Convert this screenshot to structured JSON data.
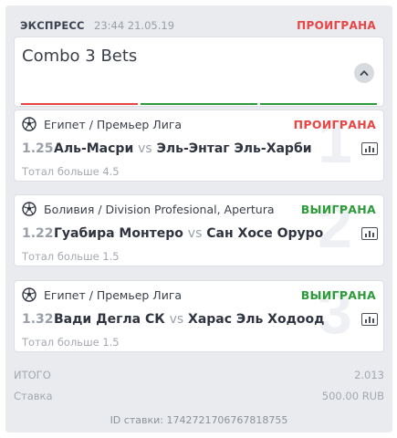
{
  "header": {
    "type": "ЭКСПРЕСС",
    "datetime": "23:44 21.05.19",
    "result": "ПРОИГРАНА",
    "result_color": "#e84545"
  },
  "combo": {
    "title": "Combo 3 Bets",
    "collapse_icon": "chevron-up-icon",
    "segments": [
      {
        "status": "lost",
        "color": "#e84545"
      },
      {
        "status": "won",
        "color": "#2e9b3a"
      },
      {
        "status": "won",
        "color": "#2e9b3a"
      }
    ]
  },
  "bets": [
    {
      "number": "1",
      "league": "Египет / Премьер Лига",
      "status": "ПРОИГРАНА",
      "status_color": "#e84545",
      "odds": "1.25",
      "home": "Аль-Масри",
      "vs": "vs",
      "away": "Эль-Энтаг Эль-Харби",
      "market": "Тотал больше 4.5"
    },
    {
      "number": "2",
      "league": "Боливия / Division Profesional, Apertura",
      "status": "ВЫИГРАНА",
      "status_color": "#2e9b3a",
      "odds": "1.22",
      "home": "Гуабира Монтеро",
      "vs": "vs",
      "away": "Сан Хосе Оруро",
      "market": "Тотал больше 1.5"
    },
    {
      "number": "3",
      "league": "Египет / Премьер Лига",
      "status": "ВЫИГРАНА",
      "status_color": "#2e9b3a",
      "odds": "1.32",
      "home": "Вади Дегла СК",
      "vs": "vs",
      "away": "Харас Эль Ходоод",
      "market": "Тотал больше 1.5"
    }
  ],
  "summary": {
    "total_label": "ИТОГО",
    "total_value": "2.013",
    "stake_label": "Ставка",
    "stake_value": "500.00 RUB",
    "bet_id": "ID ставки: 1742721706767818755"
  }
}
